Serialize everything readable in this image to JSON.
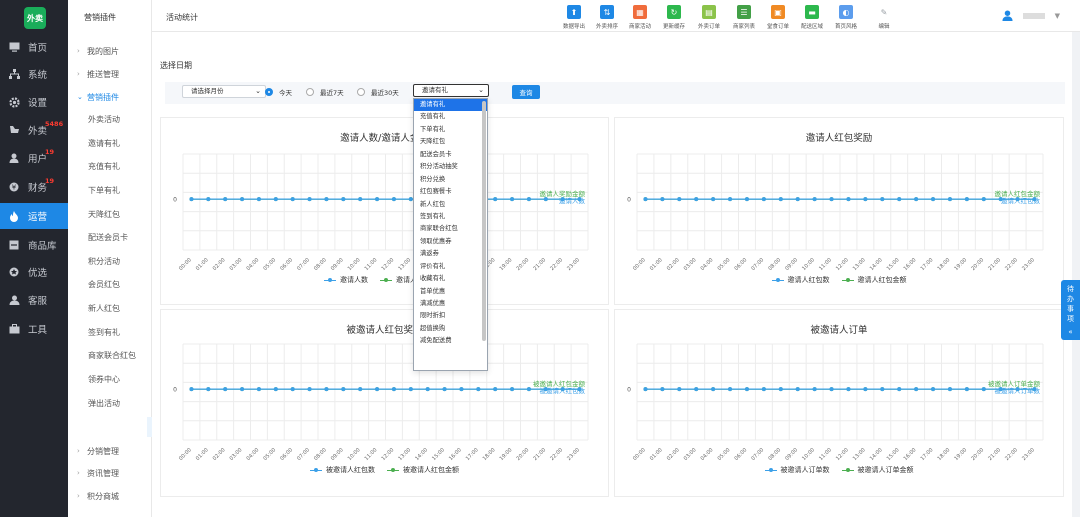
{
  "logo": "外卖",
  "sidebar": [
    {
      "label": "首页",
      "icon": "monitor-icon",
      "badge": ""
    },
    {
      "label": "系统",
      "icon": "sitemap-icon",
      "badge": ""
    },
    {
      "label": "设置",
      "icon": "gear-icon",
      "badge": ""
    },
    {
      "label": "外卖",
      "icon": "shop-icon",
      "badge": "5486"
    },
    {
      "label": "用户",
      "icon": "user-icon",
      "badge": "19"
    },
    {
      "label": "财务",
      "icon": "finance-icon",
      "badge": "19"
    },
    {
      "label": "运营",
      "icon": "fire-icon",
      "badge": ""
    },
    {
      "label": "商品库",
      "icon": "box-icon",
      "badge": ""
    },
    {
      "label": "优选",
      "icon": "star-icon",
      "badge": ""
    },
    {
      "label": "客服",
      "icon": "headset-icon",
      "badge": ""
    },
    {
      "label": "工具",
      "icon": "briefcase-icon",
      "badge": ""
    }
  ],
  "submenu": {
    "title": "营销插件",
    "groups_top": [
      "我的图片",
      "推送管理"
    ],
    "open_group": "营销插件",
    "children": [
      "外卖活动",
      "邀请有礼",
      "充值有礼",
      "下单有礼",
      "天降红包",
      "配送会员卡",
      "积分活动",
      "会员红包",
      "新人红包",
      "签到有礼",
      "商家联合红包",
      "领券中心",
      "弹出活动",
      "活动统计"
    ],
    "groups_bottom": [
      "分销管理",
      "资讯管理",
      "积分商城"
    ]
  },
  "header": {
    "crumb": "活动统计",
    "toolbar": [
      {
        "label": "数据导出",
        "icon": "export-icon",
        "color": "#1e88e5"
      },
      {
        "label": "外卖排序",
        "icon": "sort-icon",
        "color": "#1e88e5"
      },
      {
        "label": "商家活动",
        "icon": "gift-icon",
        "color": "#f06c3c"
      },
      {
        "label": "更新缓存",
        "icon": "refresh-icon",
        "color": "#2db84d"
      },
      {
        "label": "外卖订单",
        "icon": "order-icon",
        "color": "#8bc34a"
      },
      {
        "label": "商家列表",
        "icon": "list-icon",
        "color": "#43a047"
      },
      {
        "label": "堂食订单",
        "icon": "dine-icon",
        "color": "#f08a24"
      },
      {
        "label": "配送区域",
        "icon": "truck-icon",
        "color": "#2db84d"
      },
      {
        "label": "首页风格",
        "icon": "palette-icon",
        "color": "#5c9ded"
      },
      {
        "label": "编辑",
        "icon": "pencil-icon",
        "color": "#9aa0a6"
      }
    ]
  },
  "filter": {
    "label": "选择日期",
    "month_select": "请选择月份",
    "radios": [
      "今天",
      "最近7天",
      "最近30天"
    ],
    "activity_select": "邀请有礼",
    "query": "查询"
  },
  "dropdown": [
    "邀请有礼",
    "充值有礼",
    "下单有礼",
    "天降红包",
    "配送会员卡",
    "积分活动抽奖",
    "积分兑换",
    "红包赛餐卡",
    "新人红包",
    "签到有礼",
    "商家联合红包",
    "领取优惠券",
    "满返券",
    "评价有礼",
    "收藏有礼",
    "首单优惠",
    "满减优惠",
    "限时折扣",
    "超值换购",
    "减免配送费"
  ],
  "todo": "待办事项",
  "chart_data": [
    {
      "type": "line",
      "title": "邀请人数/邀请人金额",
      "x": [
        "00:00",
        "01:00",
        "02:00",
        "03:00",
        "04:00",
        "05:00",
        "06:00",
        "07:00",
        "08:00",
        "09:00",
        "10:00",
        "11:00",
        "12:00",
        "13:00",
        "14:00",
        "15:00",
        "16:00",
        "17:00",
        "18:00",
        "19:00",
        "20:00",
        "21:00",
        "22:00",
        "23:00"
      ],
      "series": [
        {
          "name": "邀请人数",
          "color": "#3ca0e8",
          "values": [
            0,
            0,
            0,
            0,
            0,
            0,
            0,
            0,
            0,
            0,
            0,
            0,
            0,
            0,
            0,
            0,
            0,
            0,
            0,
            0,
            0,
            0,
            0,
            0
          ]
        },
        {
          "name": "邀请人奖励金额",
          "color": "#4caf50",
          "values": [
            0,
            0,
            0,
            0,
            0,
            0,
            0,
            0,
            0,
            0,
            0,
            0,
            0,
            0,
            0,
            0,
            0,
            0,
            0,
            0,
            0,
            0,
            0,
            0
          ]
        }
      ],
      "y_tick": "0",
      "grid": true
    },
    {
      "type": "line",
      "title": "邀请人红包奖励",
      "x": [
        "00:00",
        "01:00",
        "02:00",
        "03:00",
        "04:00",
        "05:00",
        "06:00",
        "07:00",
        "08:00",
        "09:00",
        "10:00",
        "11:00",
        "12:00",
        "13:00",
        "14:00",
        "15:00",
        "16:00",
        "17:00",
        "18:00",
        "19:00",
        "20:00",
        "21:00",
        "22:00",
        "23:00"
      ],
      "series": [
        {
          "name": "邀请人红包数",
          "color": "#3ca0e8",
          "values": [
            0,
            0,
            0,
            0,
            0,
            0,
            0,
            0,
            0,
            0,
            0,
            0,
            0,
            0,
            0,
            0,
            0,
            0,
            0,
            0,
            0,
            0,
            0,
            0
          ]
        },
        {
          "name": "邀请人红包金额",
          "color": "#4caf50",
          "values": [
            0,
            0,
            0,
            0,
            0,
            0,
            0,
            0,
            0,
            0,
            0,
            0,
            0,
            0,
            0,
            0,
            0,
            0,
            0,
            0,
            0,
            0,
            0,
            0
          ]
        }
      ],
      "y_tick": "0",
      "grid": true
    },
    {
      "type": "line",
      "title": "被邀请人红包奖励",
      "x": [
        "00:00",
        "01:00",
        "02:00",
        "03:00",
        "04:00",
        "05:00",
        "06:00",
        "07:00",
        "08:00",
        "09:00",
        "10:00",
        "11:00",
        "12:00",
        "13:00",
        "14:00",
        "15:00",
        "16:00",
        "17:00",
        "18:00",
        "19:00",
        "20:00",
        "21:00",
        "22:00",
        "23:00"
      ],
      "series": [
        {
          "name": "被邀请人红包数",
          "color": "#3ca0e8",
          "values": [
            0,
            0,
            0,
            0,
            0,
            0,
            0,
            0,
            0,
            0,
            0,
            0,
            0,
            0,
            0,
            0,
            0,
            0,
            0,
            0,
            0,
            0,
            0,
            0
          ]
        },
        {
          "name": "被邀请人红包金额",
          "color": "#4caf50",
          "values": [
            0,
            0,
            0,
            0,
            0,
            0,
            0,
            0,
            0,
            0,
            0,
            0,
            0,
            0,
            0,
            0,
            0,
            0,
            0,
            0,
            0,
            0,
            0,
            0
          ]
        }
      ],
      "y_tick": "0",
      "grid": true
    },
    {
      "type": "line",
      "title": "被邀请人订单",
      "x": [
        "00:00",
        "01:00",
        "02:00",
        "03:00",
        "04:00",
        "05:00",
        "06:00",
        "07:00",
        "08:00",
        "09:00",
        "10:00",
        "11:00",
        "12:00",
        "13:00",
        "14:00",
        "15:00",
        "16:00",
        "17:00",
        "18:00",
        "19:00",
        "20:00",
        "21:00",
        "22:00",
        "23:00"
      ],
      "series": [
        {
          "name": "被邀请人订单数",
          "color": "#3ca0e8",
          "values": [
            0,
            0,
            0,
            0,
            0,
            0,
            0,
            0,
            0,
            0,
            0,
            0,
            0,
            0,
            0,
            0,
            0,
            0,
            0,
            0,
            0,
            0,
            0,
            0
          ]
        },
        {
          "name": "被邀请人订单金额",
          "color": "#4caf50",
          "values": [
            0,
            0,
            0,
            0,
            0,
            0,
            0,
            0,
            0,
            0,
            0,
            0,
            0,
            0,
            0,
            0,
            0,
            0,
            0,
            0,
            0,
            0,
            0,
            0
          ]
        }
      ],
      "y_tick": "0",
      "grid": true
    }
  ]
}
